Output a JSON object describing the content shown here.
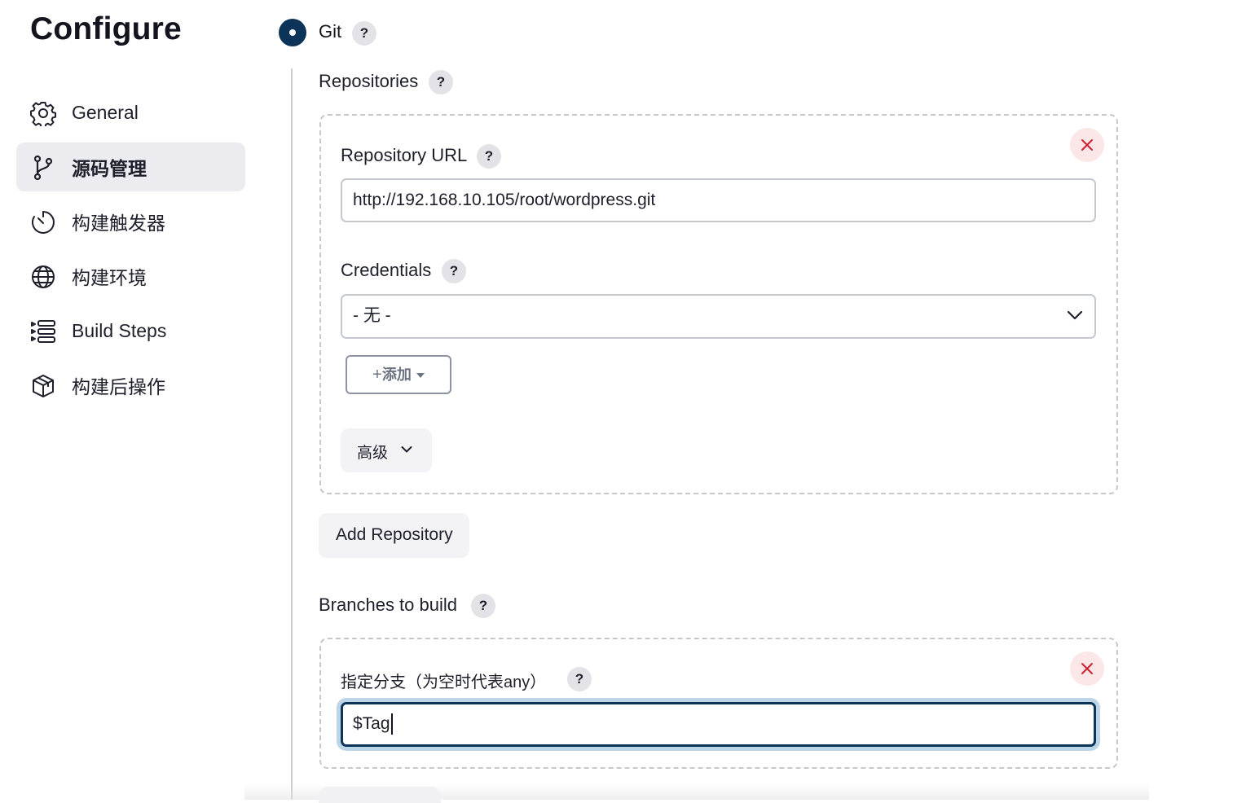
{
  "page": {
    "title": "Configure"
  },
  "sidebar": {
    "items": [
      {
        "label": "General",
        "icon": "gear-icon",
        "active": false
      },
      {
        "label": "源码管理",
        "icon": "git-branch-icon",
        "active": true
      },
      {
        "label": "构建触发器",
        "icon": "timer-icon",
        "active": false
      },
      {
        "label": "构建环境",
        "icon": "globe-icon",
        "active": false
      },
      {
        "label": "Build Steps",
        "icon": "list-steps-icon",
        "active": false
      },
      {
        "label": "构建后操作",
        "icon": "package-icon",
        "active": false
      }
    ]
  },
  "scm": {
    "option_label": "Git",
    "repositories_label": "Repositories",
    "repository": {
      "url_label": "Repository URL",
      "url_value": "http://192.168.10.105/root/wordpress.git",
      "credentials_label": "Credentials",
      "credentials_value": "- 无 -",
      "add_label": "添加",
      "advanced_label": "高级"
    },
    "add_repository_label": "Add Repository",
    "branches_label": "Branches to build",
    "branch": {
      "specifier_label": "指定分支（为空时代表any）",
      "specifier_value": "$Tag"
    }
  },
  "help_glyph": "?",
  "colors": {
    "accent": "#0c3358",
    "active_sidebar_bg": "#ebebf0",
    "danger_bg": "#fbe6e8",
    "danger": "#d0202f",
    "focus_ring": "#bcd6e8"
  }
}
